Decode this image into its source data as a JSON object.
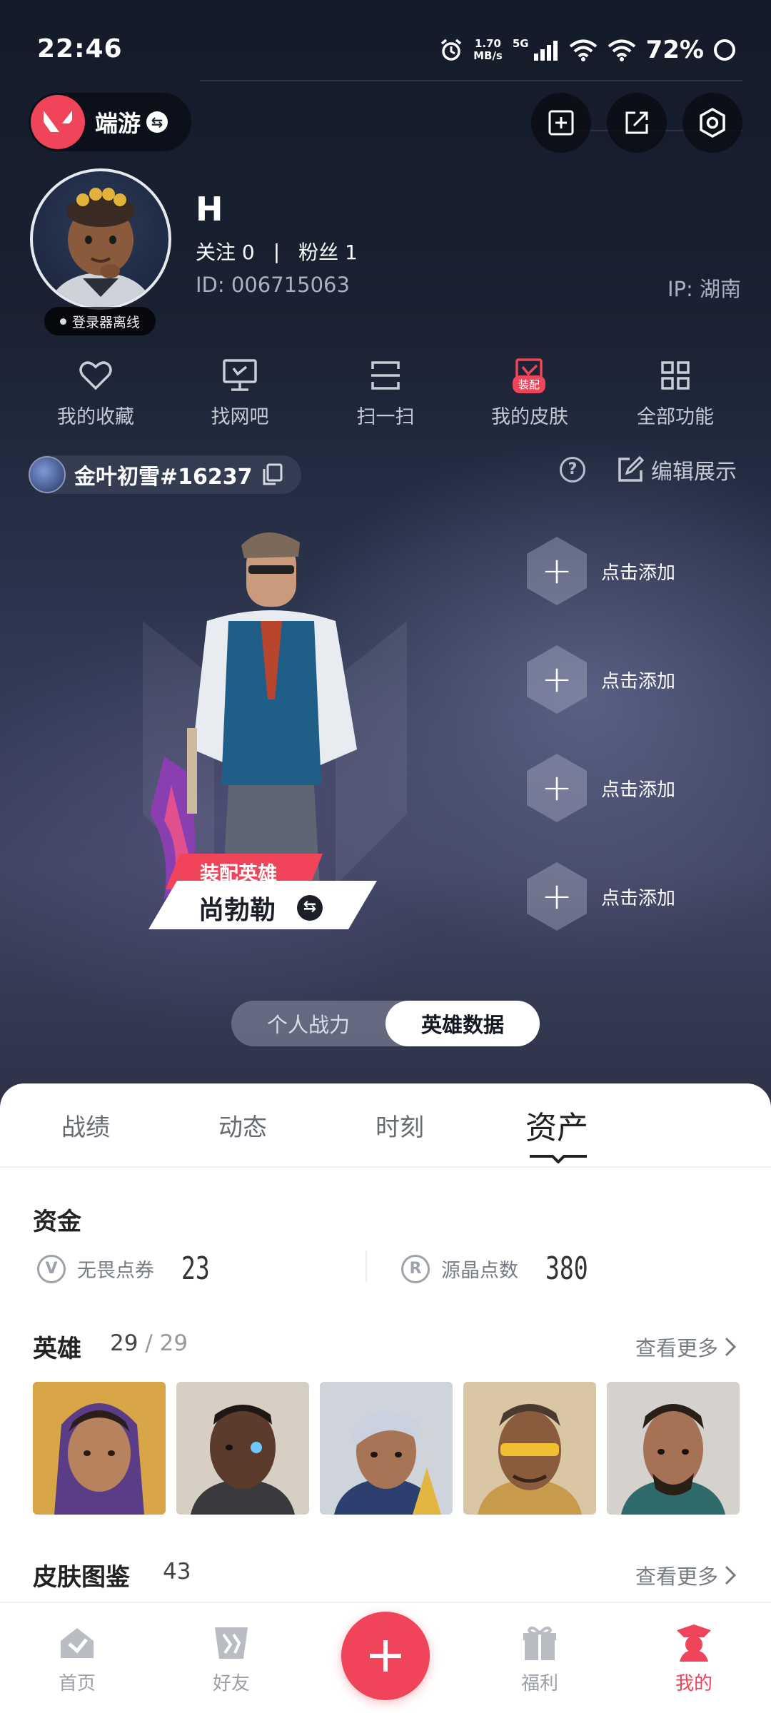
{
  "status_bar": {
    "time": "22:46",
    "speed_value": "1.70",
    "speed_unit": "MB/s",
    "network": "5G",
    "battery": "72%"
  },
  "header": {
    "app_name": "端游"
  },
  "profile": {
    "name": "H",
    "follow": "关注 0",
    "fans": "粉丝 1",
    "follow_separator": "|",
    "id": "ID:  006715063",
    "ip": "IP:  湖南",
    "status_badge": "登录器离线"
  },
  "functions": [
    {
      "label": "我的收藏",
      "icon": "heart-icon"
    },
    {
      "label": "找网吧",
      "icon": "monitor-icon"
    },
    {
      "label": "扫一扫",
      "icon": "scan-icon"
    },
    {
      "label": "我的皮肤",
      "icon": "skin-icon",
      "badge": "装配"
    },
    {
      "label": "全部功能",
      "icon": "grid-icon"
    }
  ],
  "riot": {
    "id": "金叶初雪#16237",
    "edit_label": "编辑展示"
  },
  "showcase": {
    "equip_label": "装配英雄",
    "agent_name": "尚勃勒",
    "add_slots": [
      "点击添加",
      "点击添加",
      "点击添加",
      "点击添加"
    ]
  },
  "toggle": {
    "options": [
      "个人战力",
      "英雄数据"
    ],
    "active": "英雄数据"
  },
  "tabs": [
    "战绩",
    "动态",
    "时刻",
    "资产"
  ],
  "active_tab": "资产",
  "funds": {
    "title": "资金",
    "items": [
      {
        "label": "无畏点券",
        "value": "23",
        "icon": "vp-icon"
      },
      {
        "label": "源晶点数",
        "value": "380",
        "icon": "radianite-icon"
      }
    ]
  },
  "agents_section": {
    "title": "英雄",
    "owned": "29",
    "total": "29",
    "see_more": "查看更多"
  },
  "skins_section": {
    "title": "皮肤图鉴",
    "count": "43",
    "see_more": "查看更多"
  },
  "bottom_nav": [
    {
      "label": "首页",
      "icon": "home-icon"
    },
    {
      "label": "好友",
      "icon": "friends-icon"
    },
    {
      "label": "福利",
      "icon": "gift-icon"
    },
    {
      "label": "我的",
      "icon": "profile-icon"
    }
  ],
  "colors": {
    "accent": "#f0445a",
    "panel": "#ffffff",
    "hero_dark": "#1b2232"
  }
}
